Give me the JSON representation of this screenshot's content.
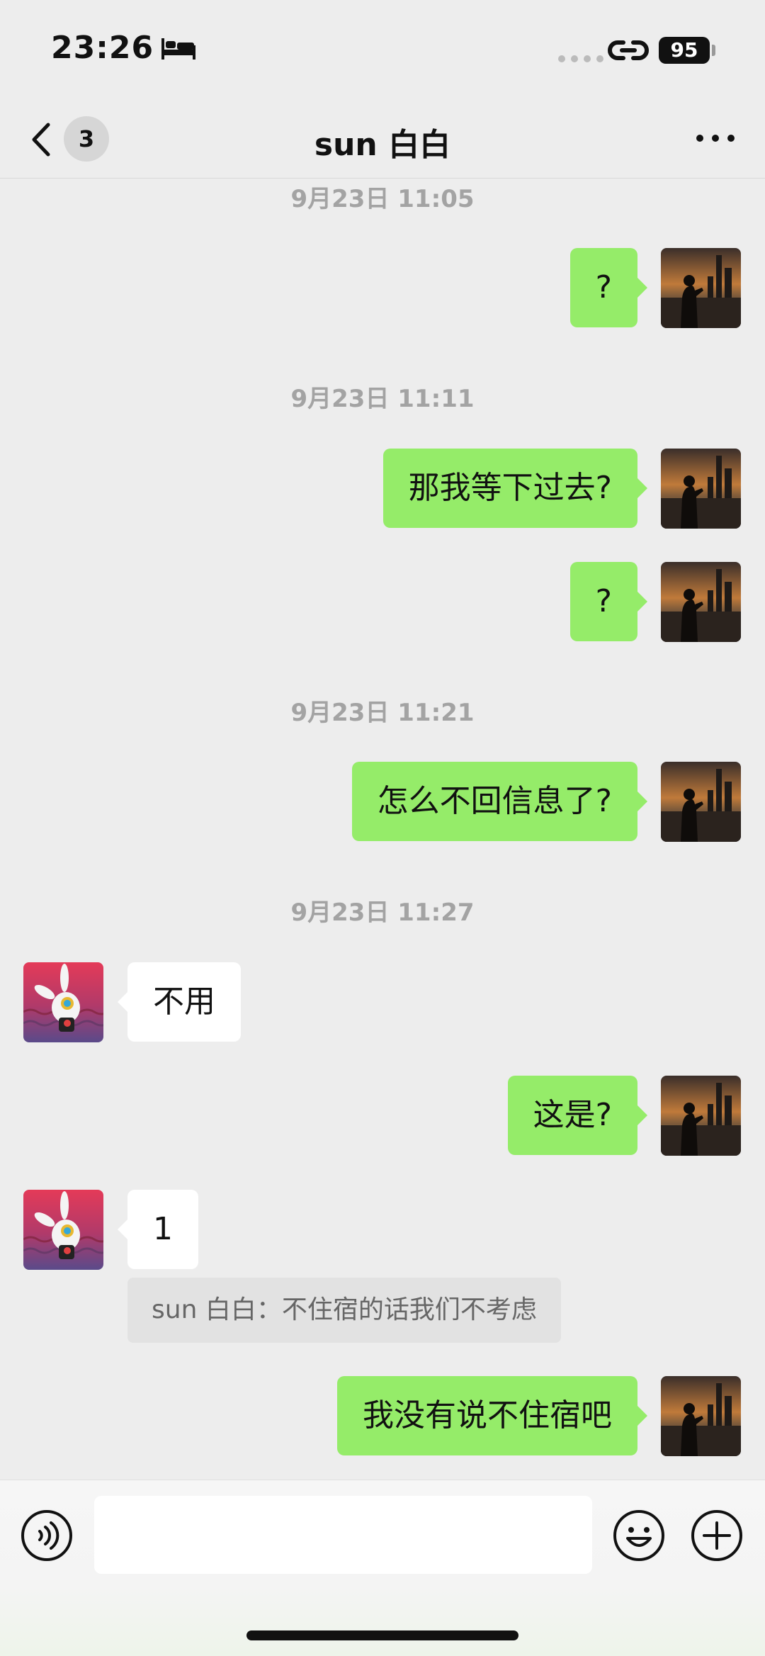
{
  "status_bar": {
    "time": "23:26",
    "battery": "95",
    "icons": [
      "bed-icon",
      "signal-dots-icon",
      "link-icon",
      "battery-icon"
    ]
  },
  "header": {
    "back_badge": "3",
    "title": "sun 白白",
    "icons": [
      "chevron-left-icon",
      "more-icon"
    ]
  },
  "messages": {
    "ts1": "9月23日 11:05",
    "m1": "?",
    "ts2": "9月23日 11:11",
    "m2": "那我等下过去?",
    "m3": "?",
    "ts3": "9月23日 11:21",
    "m4": "怎么不回信息了?",
    "ts4": "9月23日 11:27",
    "m5": "不用",
    "m6": "这是?",
    "m7": "1",
    "m7_quote": "sun 白白：不住宿的话我们不考虑",
    "m8": "我没有说不住宿吧"
  },
  "input_bar": {
    "value": "",
    "placeholder": "",
    "icons": [
      "voice-icon",
      "emoji-icon",
      "plus-icon"
    ]
  },
  "colors": {
    "background": "#ededed",
    "self_bubble": "#95ec69",
    "other_bubble": "#ffffff",
    "timestamp_text": "#a3a3a3"
  }
}
